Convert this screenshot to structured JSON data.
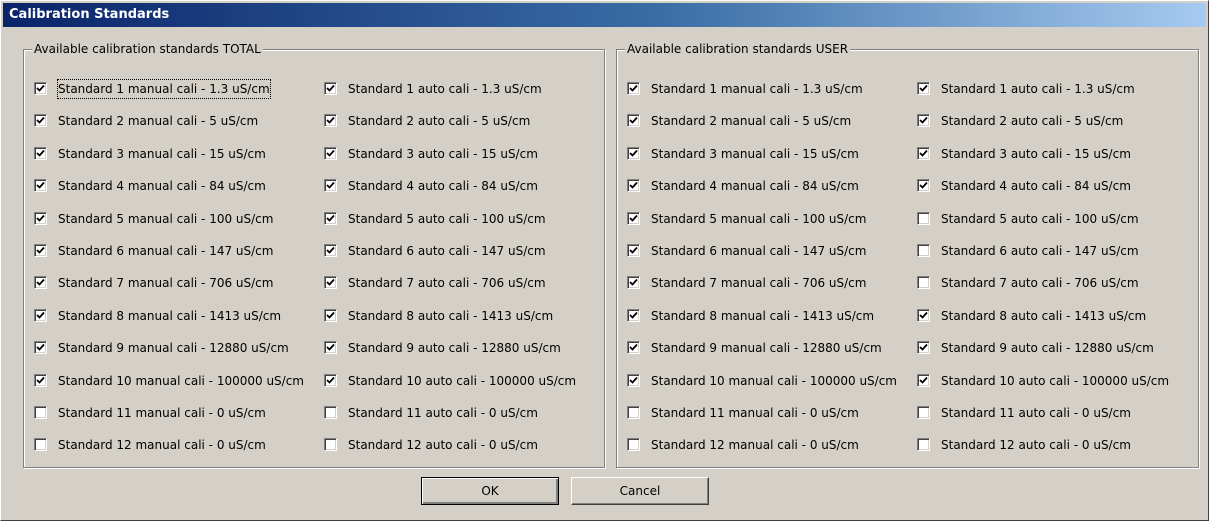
{
  "window": {
    "title": "Calibration Standards"
  },
  "groups": [
    {
      "title": "Available calibration standards TOTAL",
      "columns": [
        [
          {
            "label": "Standard 1 manual cali - 1.3 uS/cm",
            "checked": true
          },
          {
            "label": "Standard 2 manual cali - 5 uS/cm",
            "checked": true
          },
          {
            "label": "Standard 3 manual cali - 15 uS/cm",
            "checked": true
          },
          {
            "label": "Standard 4 manual cali - 84 uS/cm",
            "checked": true
          },
          {
            "label": "Standard 5 manual cali - 100 uS/cm",
            "checked": true
          },
          {
            "label": "Standard 6 manual cali - 147 uS/cm",
            "checked": true
          },
          {
            "label": "Standard 7 manual cali - 706 uS/cm",
            "checked": true
          },
          {
            "label": "Standard 8 manual cali - 1413 uS/cm",
            "checked": true
          },
          {
            "label": "Standard 9 manual cali - 12880 uS/cm",
            "checked": true
          },
          {
            "label": "Standard 10 manual cali - 100000 uS/cm",
            "checked": true
          },
          {
            "label": "Standard 11 manual cali - 0 uS/cm",
            "checked": false
          },
          {
            "label": "Standard 12 manual cali - 0 uS/cm",
            "checked": false
          }
        ],
        [
          {
            "label": "Standard 1 auto cali - 1.3 uS/cm",
            "checked": true
          },
          {
            "label": "Standard 2 auto cali - 5 uS/cm",
            "checked": true
          },
          {
            "label": "Standard 3 auto cali - 15 uS/cm",
            "checked": true
          },
          {
            "label": "Standard 4 auto cali - 84 uS/cm",
            "checked": true
          },
          {
            "label": "Standard 5 auto cali - 100 uS/cm",
            "checked": true
          },
          {
            "label": "Standard 6 auto cali - 147 uS/cm",
            "checked": true
          },
          {
            "label": "Standard 7 auto cali - 706 uS/cm",
            "checked": true
          },
          {
            "label": "Standard 8 auto cali - 1413 uS/cm",
            "checked": true
          },
          {
            "label": "Standard 9 auto cali - 12880 uS/cm",
            "checked": true
          },
          {
            "label": "Standard 10 auto cali - 100000 uS/cm",
            "checked": true
          },
          {
            "label": "Standard 11 auto cali - 0 uS/cm",
            "checked": false
          },
          {
            "label": "Standard 12 auto cali - 0 uS/cm",
            "checked": false
          }
        ]
      ]
    },
    {
      "title": "Available calibration standards USER",
      "columns": [
        [
          {
            "label": "Standard 1 manual cali - 1.3 uS/cm",
            "checked": true
          },
          {
            "label": "Standard 2 manual cali - 5 uS/cm",
            "checked": true
          },
          {
            "label": "Standard 3 manual cali - 15 uS/cm",
            "checked": true
          },
          {
            "label": "Standard 4 manual cali - 84 uS/cm",
            "checked": true
          },
          {
            "label": "Standard 5 manual cali - 100 uS/cm",
            "checked": true
          },
          {
            "label": "Standard 6 manual cali - 147 uS/cm",
            "checked": true
          },
          {
            "label": "Standard 7 manual cali - 706 uS/cm",
            "checked": true
          },
          {
            "label": "Standard 8 manual cali - 1413 uS/cm",
            "checked": true
          },
          {
            "label": "Standard 9 manual cali - 12880 uS/cm",
            "checked": true
          },
          {
            "label": "Standard 10 manual cali - 100000 uS/cm",
            "checked": true
          },
          {
            "label": "Standard 11 manual cali - 0 uS/cm",
            "checked": false
          },
          {
            "label": "Standard 12 manual cali - 0 uS/cm",
            "checked": false
          }
        ],
        [
          {
            "label": "Standard 1 auto cali - 1.3 uS/cm",
            "checked": true
          },
          {
            "label": "Standard 2 auto cali - 5 uS/cm",
            "checked": true
          },
          {
            "label": "Standard 3 auto cali - 15 uS/cm",
            "checked": true
          },
          {
            "label": "Standard 4 auto cali - 84 uS/cm",
            "checked": true
          },
          {
            "label": "Standard 5 auto cali - 100 uS/cm",
            "checked": false
          },
          {
            "label": "Standard 6 auto cali - 147 uS/cm",
            "checked": false
          },
          {
            "label": "Standard 7 auto cali - 706 uS/cm",
            "checked": false
          },
          {
            "label": "Standard 8 auto cali - 1413 uS/cm",
            "checked": true
          },
          {
            "label": "Standard 9 auto cali - 12880 uS/cm",
            "checked": true
          },
          {
            "label": "Standard 10 auto cali - 100000 uS/cm",
            "checked": true
          },
          {
            "label": "Standard 11 auto cali - 0 uS/cm",
            "checked": false
          },
          {
            "label": "Standard 12 auto cali - 0 uS/cm",
            "checked": false
          }
        ]
      ]
    }
  ],
  "buttons": {
    "ok_label": "OK",
    "cancel_label": "Cancel"
  },
  "colors": {
    "title_bar_start": "#0a246a",
    "title_bar_end": "#a6caf0",
    "dialog_background": "#d4d0c8"
  },
  "icons": {
    "checkbox_mark": "check-mark-icon"
  }
}
